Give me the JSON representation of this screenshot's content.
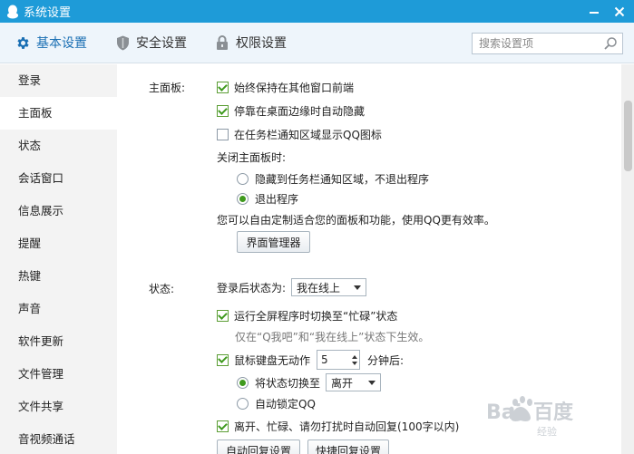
{
  "window": {
    "title": "系统设置"
  },
  "toolbar": {
    "tabs": [
      {
        "label": "基本设置",
        "icon": "gear-icon",
        "active": true
      },
      {
        "label": "安全设置",
        "icon": "shield-icon",
        "active": false
      },
      {
        "label": "权限设置",
        "icon": "lock-icon",
        "active": false
      }
    ],
    "search_placeholder": "搜索设置项"
  },
  "sidebar": {
    "items": [
      {
        "label": "登录",
        "active": false
      },
      {
        "label": "主面板",
        "active": true
      },
      {
        "label": "状态",
        "active": false
      },
      {
        "label": "会话窗口",
        "active": false
      },
      {
        "label": "信息展示",
        "active": false
      },
      {
        "label": "提醒",
        "active": false
      },
      {
        "label": "热键",
        "active": false
      },
      {
        "label": "声音",
        "active": false
      },
      {
        "label": "软件更新",
        "active": false
      },
      {
        "label": "文件管理",
        "active": false
      },
      {
        "label": "文件共享",
        "active": false
      },
      {
        "label": "音视频通话",
        "active": false
      }
    ]
  },
  "panel": {
    "section_label": "主面板:",
    "always_on_top": {
      "label": "始终保持在其他窗口前端",
      "checked": true
    },
    "auto_hide": {
      "label": "停靠在桌面边缘时自动隐藏",
      "checked": true
    },
    "tray_icon": {
      "label": "在任务栏通知区域显示QQ图标",
      "checked": false
    },
    "close_label": "关闭主面板时:",
    "close_hide": {
      "label": "隐藏到任务栏通知区域，不退出程序",
      "checked": false
    },
    "close_exit": {
      "label": "退出程序",
      "checked": true
    },
    "customize_text": "您可以自由定制适合您的面板和功能，使用QQ更有效率。",
    "ui_manager_button": "界面管理器"
  },
  "status": {
    "section_label": "状态:",
    "after_login_label": "登录后状态为:",
    "after_login_value": "我在线上",
    "fullscreen_busy": {
      "label": "运行全屏程序时切换至“忙碌”状态",
      "checked": true
    },
    "fullscreen_hint": "仅在“Q我吧”和“我在线上”状态下生效。",
    "idle": {
      "label": "鼠标键盘无动作",
      "checked": true
    },
    "idle_minutes": "5",
    "idle_suffix": "分钟后:",
    "switch_to": {
      "label": "将状态切换至",
      "checked": true
    },
    "switch_to_value": "离开",
    "auto_lock": {
      "label": "自动锁定QQ",
      "checked": false
    },
    "auto_reply": {
      "label": "离开、忙碌、请勿打扰时自动回复(100字以内)",
      "checked": true
    },
    "auto_reply_button": "自动回复设置",
    "quick_reply_button": "快捷回复设置"
  }
}
